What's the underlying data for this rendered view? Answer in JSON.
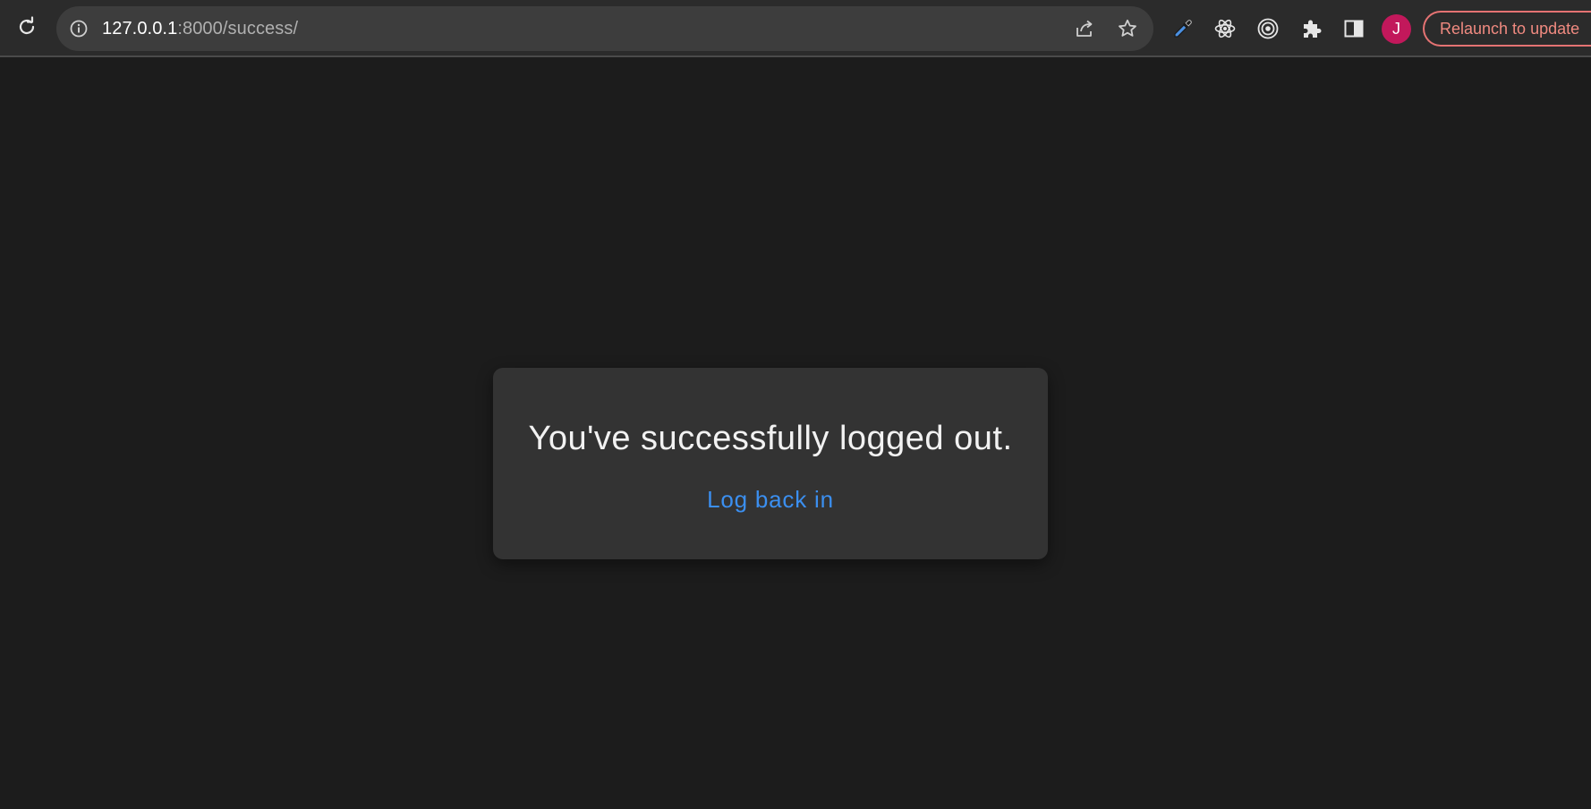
{
  "browser": {
    "url_host": "127.0.0.1",
    "url_path": ":8000/success/",
    "profile_initial": "J",
    "relaunch_label": "Relaunch to update",
    "toolbar_icons": [
      "reload-icon",
      "site-info-icon",
      "share-icon",
      "bookmark-star-icon",
      "eyedropper-icon",
      "react-devtools-icon",
      "target-extension-icon",
      "extensions-puzzle-icon",
      "side-panel-icon"
    ]
  },
  "page": {
    "message": "You've successfully logged out.",
    "link_label": "Log back in"
  },
  "colors": {
    "background": "#1c1c1c",
    "card": "#333333",
    "link": "#3b8ff0",
    "avatar": "#c2185b",
    "relaunch_accent": "#f08a80"
  }
}
